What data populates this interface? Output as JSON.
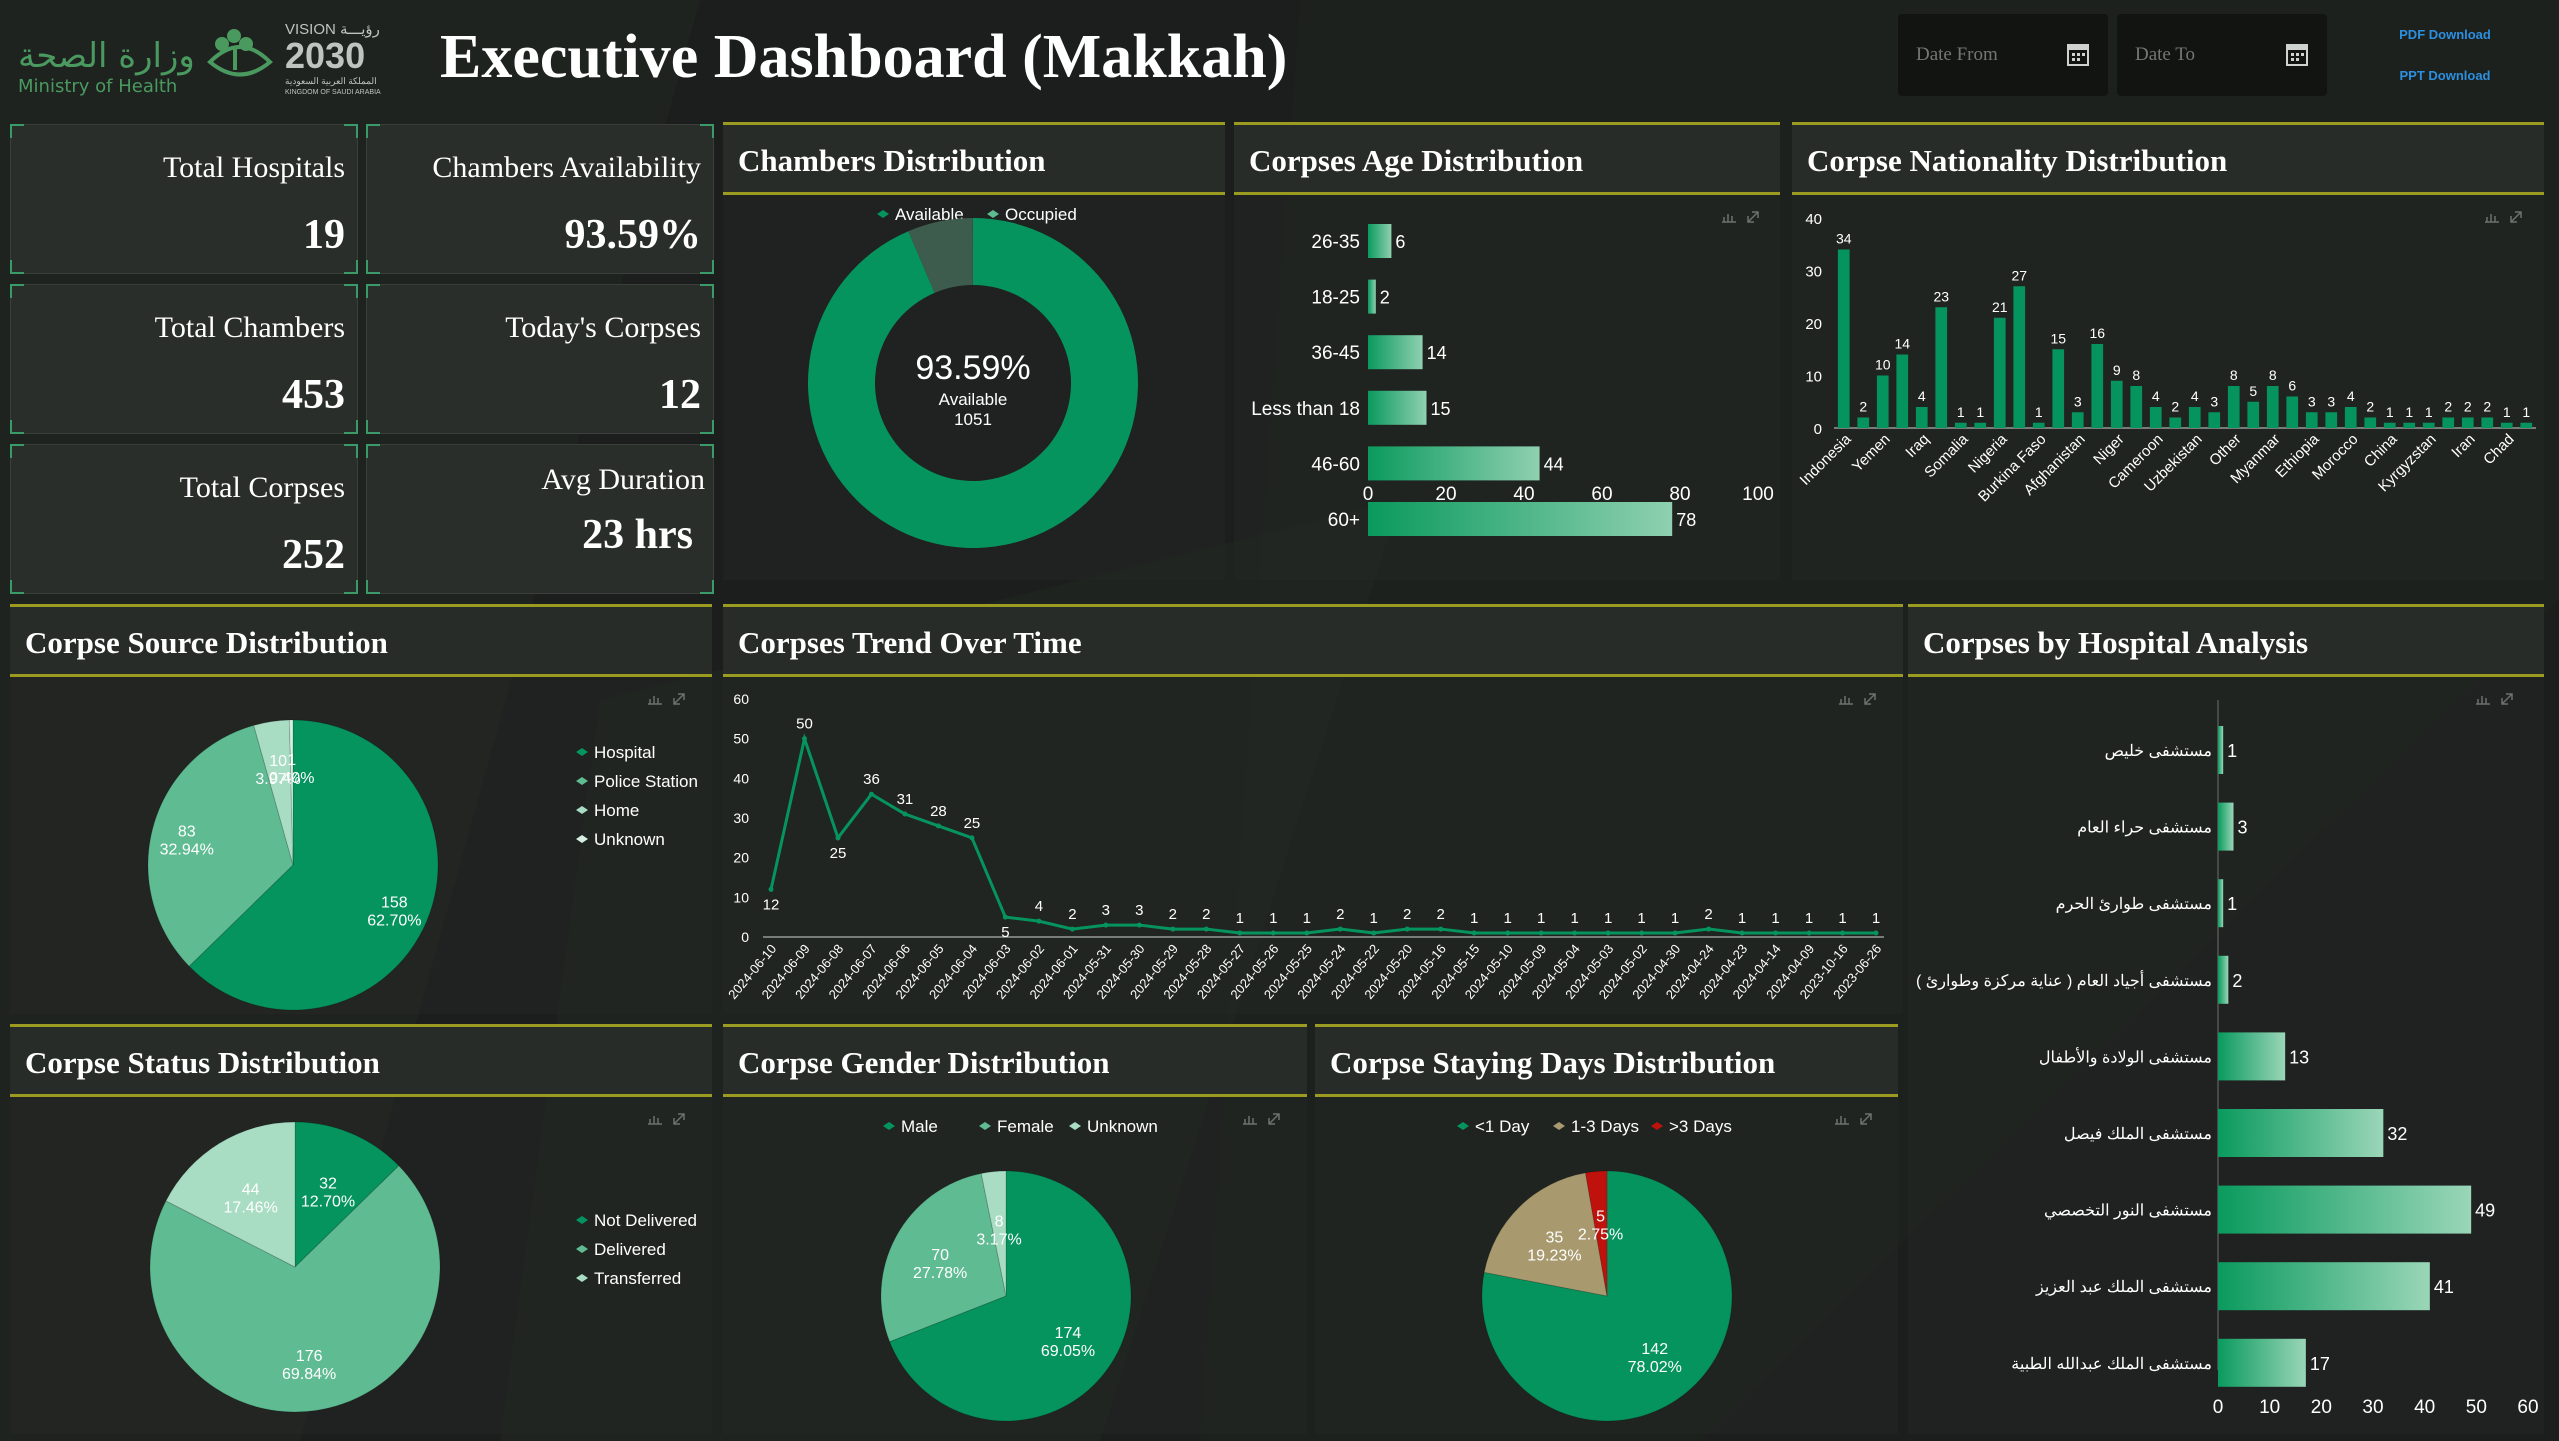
{
  "header": {
    "ministry_ar": "وزارة الصحة",
    "ministry_en": "Ministry of Health",
    "vision_label": "VISION",
    "vision_ar": "رؤيـــة",
    "vision_year": "2030",
    "vision_sub_ar": "المملكة العربية السعودية",
    "vision_sub_en": "KINGDOM OF SAUDI ARABIA",
    "title": "Executive Dashboard (Makkah)",
    "date_from_placeholder": "Date From",
    "date_to_placeholder": "Date To",
    "pdf_label": "PDF Download",
    "ppt_label": "PPT Download"
  },
  "kpis": {
    "total_hospitals": {
      "label": "Total Hospitals",
      "value": "19"
    },
    "chambers_availability": {
      "label": "Chambers Availability",
      "value": "93.59%"
    },
    "total_chambers": {
      "label": "Total Chambers",
      "value": "453"
    },
    "todays_corpses": {
      "label": "Today's Corpses",
      "value": "12"
    },
    "total_corpses": {
      "label": "Total Corpses",
      "value": "252"
    },
    "avg_duration": {
      "label": "Avg Duration",
      "value": "23 hrs"
    }
  },
  "panels": {
    "chambers": "Chambers Distribution",
    "age": "Corpses Age Distribution",
    "nationality": "Corpse Nationality Distribution",
    "source": "Corpse Source Distribution",
    "trend": "Corpses Trend Over Time",
    "hospital": "Corpses by Hospital Analysis",
    "status": "Corpse Status Distribution",
    "gender": "Corpse Gender Distribution",
    "staying": "Corpse Staying Days Distribution"
  },
  "colors": {
    "primary": "#05945e",
    "light": "#5fbb92",
    "pale": "#a8dcc3",
    "tan": "#a89a6e",
    "red": "#c0120c",
    "accent_line": "#9b9b22"
  },
  "chart_data": [
    {
      "id": "chambers",
      "type": "pie",
      "title": "Chambers Distribution",
      "legend": [
        "Available",
        "Occupied"
      ],
      "values": [
        93.59,
        6.41
      ],
      "center_text": {
        "value": "93.59%",
        "label": "Available",
        "sub": "1051"
      }
    },
    {
      "id": "age",
      "type": "bar",
      "orientation": "horizontal",
      "title": "Corpses Age Distribution",
      "categories": [
        "26-35",
        "18-25",
        "36-45",
        "Less than 18",
        "46-60",
        "60+"
      ],
      "values": [
        6,
        2,
        14,
        15,
        44,
        78
      ],
      "xlim": [
        0,
        100
      ],
      "ticks": [
        "0",
        "20",
        "40",
        "60",
        "80",
        "100"
      ]
    },
    {
      "id": "nationality",
      "type": "bar",
      "title": "Corpse Nationality Distribution",
      "values": [
        34,
        2,
        10,
        14,
        4,
        23,
        1,
        1,
        21,
        27,
        1,
        15,
        3,
        16,
        9,
        8,
        4,
        2,
        4,
        3,
        8,
        5,
        8,
        6,
        3,
        3,
        4,
        2,
        1,
        1,
        1,
        2,
        2,
        2,
        1,
        1
      ],
      "tick_labels": [
        "Indonesia",
        "Yemen",
        "Iraq",
        "Somalia",
        "Nigeria",
        "Burkina Faso",
        "Afghanistan",
        "Niger",
        "Cameroon",
        "Uzbekistan",
        "Other",
        "Myanmar",
        "Ethiopia",
        "Morocco",
        "China",
        "Kyrgyzstan",
        "Iran",
        "Chad"
      ],
      "ylim": [
        0,
        40
      ],
      "yticks": [
        "0",
        "10",
        "20",
        "30",
        "40"
      ]
    },
    {
      "id": "source",
      "type": "pie",
      "title": "Corpse Source Distribution",
      "legend": [
        "Hospital",
        "Police Station",
        "Home",
        "Unknown"
      ],
      "values": [
        158,
        83,
        10,
        1
      ],
      "labels": [
        [
          "158",
          "62.70%"
        ],
        [
          "83",
          "32.94%"
        ],
        [
          "10",
          "3.97%"
        ],
        [
          "1",
          "0.40%"
        ]
      ]
    },
    {
      "id": "trend",
      "type": "line",
      "title": "Corpses Trend Over Time",
      "x": [
        "2024-06-10",
        "2024-06-09",
        "2024-06-08",
        "2024-06-07",
        "2024-06-06",
        "2024-06-05",
        "2024-06-04",
        "2024-06-03",
        "2024-06-02",
        "2024-06-01",
        "2024-05-31",
        "2024-05-30",
        "2024-05-29",
        "2024-05-28",
        "2024-05-27",
        "2024-05-26",
        "2024-05-25",
        "2024-05-24",
        "2024-05-22",
        "2024-05-20",
        "2024-05-16",
        "2024-05-15",
        "2024-05-10",
        "2024-05-09",
        "2024-05-04",
        "2024-05-03",
        "2024-05-02",
        "2024-04-30",
        "2024-04-24",
        "2024-04-23",
        "2024-04-14",
        "2024-04-09",
        "2023-10-16",
        "2023-06-26"
      ],
      "values": [
        12,
        50,
        25,
        36,
        31,
        28,
        25,
        5,
        4,
        2,
        3,
        3,
        2,
        2,
        1,
        1,
        1,
        2,
        1,
        2,
        2,
        1,
        1,
        1,
        1,
        1,
        1,
        1,
        2,
        1,
        1,
        1,
        1,
        1
      ],
      "ylim": [
        0,
        60
      ],
      "yticks": [
        "0",
        "10",
        "20",
        "30",
        "40",
        "50",
        "60"
      ]
    },
    {
      "id": "hospital",
      "type": "bar",
      "orientation": "horizontal",
      "title": "Corpses by Hospital Analysis",
      "categories": [
        "مستشفى خليص",
        "مستشفى حراء العام",
        "مستشفى طوارئ الحرم",
        "مستشفى أجياد العام ( عناية مركزة وطوارئ )",
        "مستشفى الولادة والأطفال",
        "مستشفى الملك فيصل",
        "مستشفى النور التخصصي",
        "مستشفى الملك عبد العزيز",
        "مستشفى الملك عبدالله الطبية"
      ],
      "values": [
        1,
        3,
        1,
        2,
        13,
        32,
        49,
        41,
        17
      ],
      "xlim": [
        0,
        60
      ],
      "ticks": [
        "0",
        "10",
        "20",
        "30",
        "40",
        "50",
        "60"
      ]
    },
    {
      "id": "status",
      "type": "pie",
      "title": "Corpse Status Distribution",
      "legend": [
        "Not Delivered",
        "Delivered",
        "Transferred"
      ],
      "values": [
        176,
        44,
        32
      ],
      "labels": [
        [
          "176",
          "69.84%"
        ],
        [
          "44",
          "17.46%"
        ],
        [
          "32",
          "12.70%"
        ]
      ]
    },
    {
      "id": "gender",
      "type": "pie",
      "title": "Corpse Gender Distribution",
      "legend": [
        "Male",
        "Female",
        "Unknown"
      ],
      "values": [
        174,
        70,
        8
      ],
      "labels": [
        [
          "174",
          "69.05%"
        ],
        [
          "70",
          "27.78%"
        ],
        [
          "8",
          "3.17%"
        ]
      ]
    },
    {
      "id": "staying",
      "type": "pie",
      "title": "Corpse Staying Days Distribution",
      "legend": [
        "<1 Day",
        "1-3 Days",
        ">3 Days"
      ],
      "values": [
        142,
        35,
        5
      ],
      "labels": [
        [
          "142",
          "78.02%"
        ],
        [
          "35",
          "19.23%"
        ],
        [
          "5",
          "2.75%"
        ]
      ]
    }
  ]
}
